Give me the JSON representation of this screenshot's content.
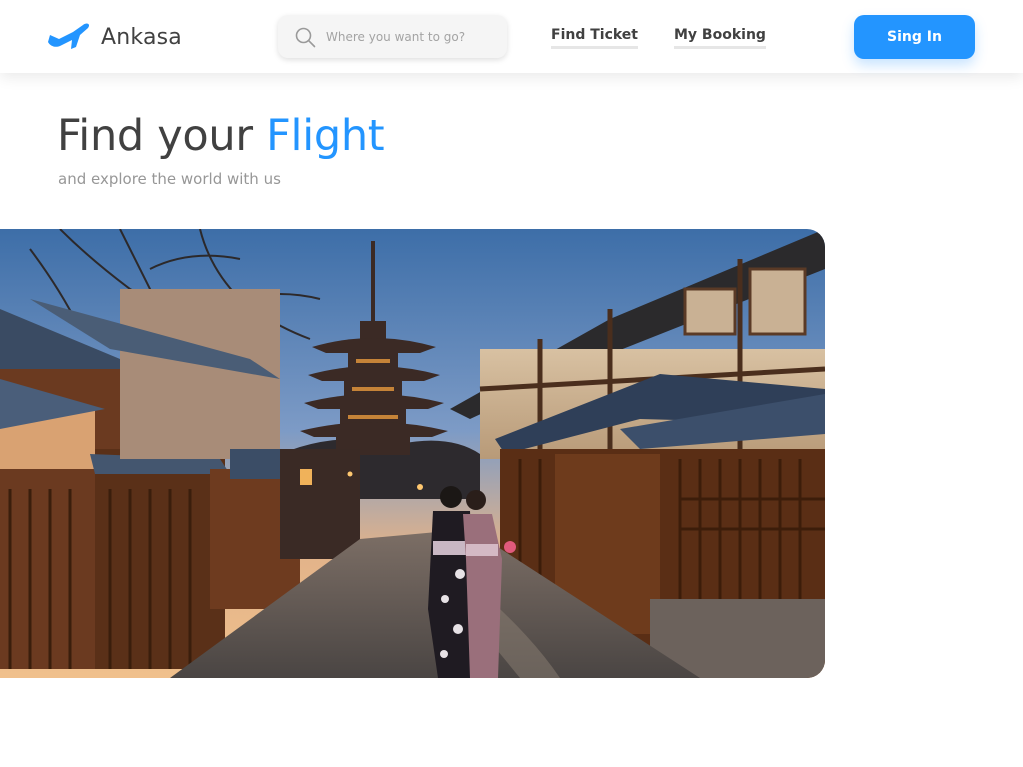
{
  "brand": {
    "name": "Ankasa",
    "icon": "airplane-icon",
    "color": "#2395FF"
  },
  "search": {
    "placeholder": "Where you want to go?",
    "value": "",
    "icon": "search-icon"
  },
  "nav": {
    "links": [
      {
        "label": "Find Ticket"
      },
      {
        "label": "My Booking"
      }
    ]
  },
  "signin": {
    "label": "Sing In"
  },
  "hero": {
    "title_main": "Find your ",
    "title_accent": "Flight",
    "subtitle": "and explore the world with us",
    "image": "kyoto-street-pagoda-sunset-photo"
  },
  "colors": {
    "accent": "#2395FF",
    "text": "#414141",
    "muted": "#979797"
  }
}
